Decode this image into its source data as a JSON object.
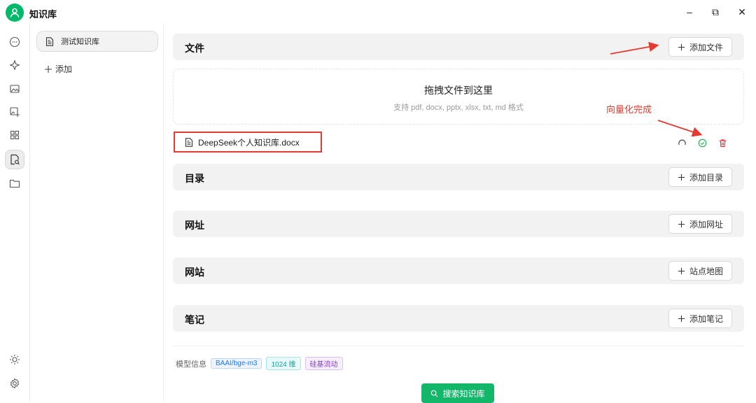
{
  "app": {
    "title": "知识库"
  },
  "window_controls": {
    "minimize": "–",
    "restore": "⧉",
    "close": "✕"
  },
  "sidebar": {
    "icons": [
      "chat-icon",
      "sparkle-icon",
      "image-icon",
      "image-add-icon",
      "apps-icon",
      "knowledge-search-icon",
      "folder-icon"
    ],
    "bottom_icons": [
      "theme-sun-icon",
      "settings-gear-icon"
    ]
  },
  "knowledge_bases": {
    "items": [
      {
        "label": "测试知识库",
        "active": true
      }
    ],
    "add_label": "添加"
  },
  "sections": {
    "files": {
      "label": "文件",
      "button": "添加文件"
    },
    "directory": {
      "label": "目录",
      "button": "添加目录"
    },
    "url": {
      "label": "网址",
      "button": "添加网址"
    },
    "website": {
      "label": "网站",
      "button": "站点地图"
    },
    "notes": {
      "label": "笔记",
      "button": "添加笔记"
    }
  },
  "dropzone": {
    "title": "拖拽文件到这里",
    "subtitle": "支持 pdf, docx, pptx, xlsx, txt, md 格式"
  },
  "file": {
    "name": "DeepSeek个人知识库.docx",
    "status": "vectorized"
  },
  "annotation": {
    "text": "向量化完成",
    "color": "#e53a30"
  },
  "model_info": {
    "label": "模型信息",
    "model": "BAAI/bge-m3",
    "dims": "1024 维",
    "provider": "硅基流动"
  },
  "search_button": {
    "label": "搜索知识库"
  },
  "colors": {
    "accent": "#12b76a",
    "annotation_red": "#e53a30",
    "delete_red": "#f5222d"
  }
}
